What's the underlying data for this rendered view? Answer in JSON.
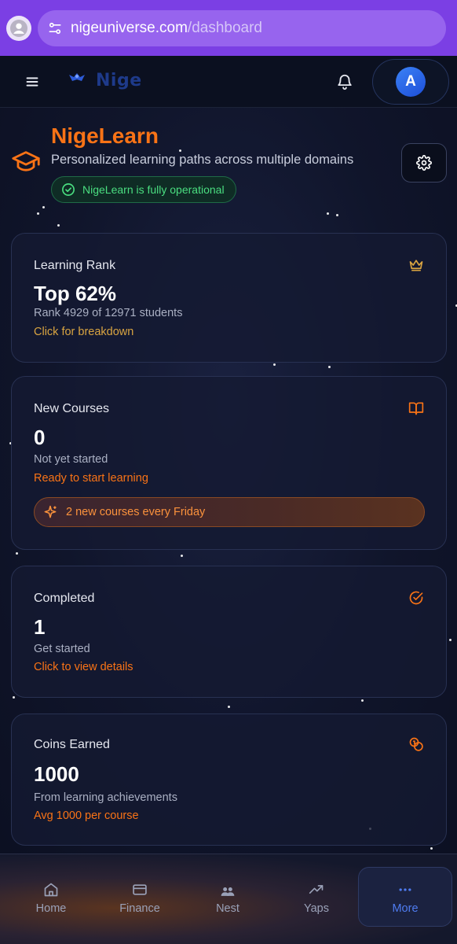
{
  "browser": {
    "url_host": "nigeuniverse.com",
    "url_path": "/dashboard"
  },
  "header": {
    "logo_text": "Nige",
    "avatar_initial": "A",
    "icons": [
      "menu-icon",
      "logo-icon",
      "bell-icon"
    ]
  },
  "hero": {
    "title": "NigeLearn",
    "subtitle": "Personalized learning paths across multiple domains",
    "status": "NigeLearn is fully operational",
    "icons": [
      "graduation-cap-icon",
      "gear-icon",
      "check-circle-icon"
    ]
  },
  "cards": {
    "rank": {
      "title": "Learning Rank",
      "value": "Top 62%",
      "desc": "Rank 4929 of 12971 students",
      "link": "Click for breakdown",
      "icon": "crown-icon"
    },
    "courses": {
      "title": "New Courses",
      "value": "0",
      "desc": "Not yet started",
      "link": "Ready to start learning",
      "banner": "2 new courses every Friday",
      "icon": "book-open-icon"
    },
    "completed": {
      "title": "Completed",
      "value": "1",
      "desc": "Get started",
      "link": "Click to view details",
      "icon": "check-circle-icon"
    },
    "coins": {
      "title": "Coins Earned",
      "value": "1000",
      "desc": "From learning achievements",
      "link": "Avg 1000 per course",
      "icon": "coins-icon"
    }
  },
  "bottom_nav": {
    "items": [
      {
        "label": "Home",
        "icon": "home-icon"
      },
      {
        "label": "Finance",
        "icon": "card-icon"
      },
      {
        "label": "Nest",
        "icon": "users-icon"
      },
      {
        "label": "Yaps",
        "icon": "trending-up-icon"
      },
      {
        "label": "More",
        "icon": "more-icon",
        "active": true
      }
    ]
  },
  "colors": {
    "accent_orange": "#f97316",
    "accent_gold": "#d9a441",
    "success_green": "#4ade80",
    "active_blue": "#4f7cf0",
    "browser_purple": "#7b3fe4"
  }
}
